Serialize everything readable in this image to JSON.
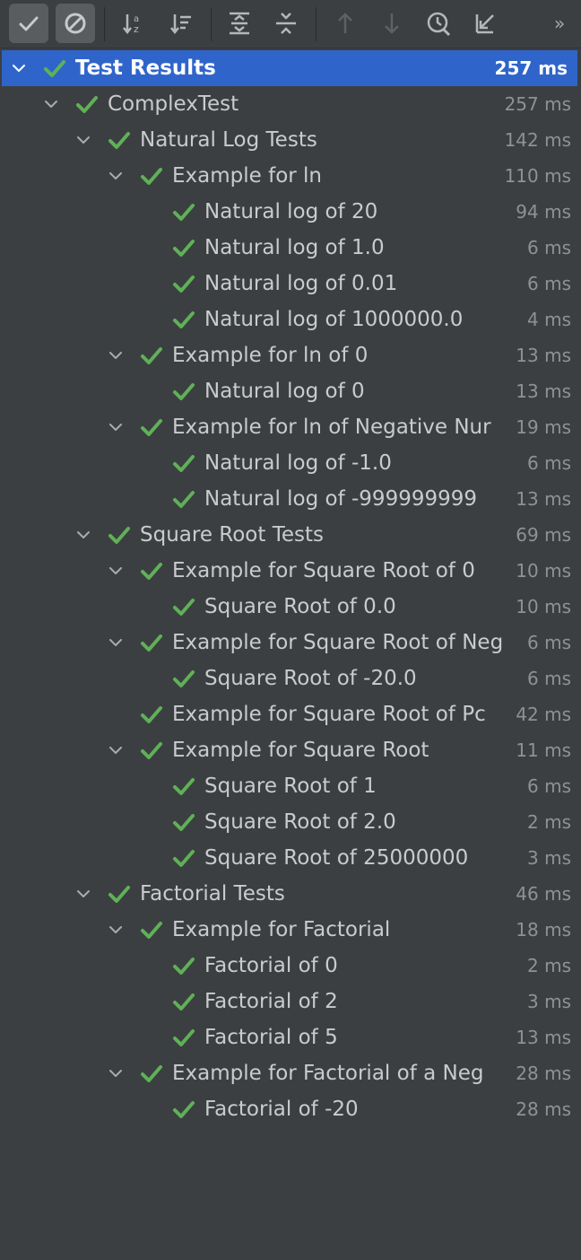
{
  "colors": {
    "background": "#3c3f41",
    "selection": "#2f65ca",
    "pass_check": "#5fb157",
    "text": "#c9cbcd",
    "time_text": "#8f9295"
  },
  "toolbar": {
    "buttons": [
      {
        "icon": "show-passed-icon",
        "active": true
      },
      {
        "icon": "show-ignored-icon",
        "active": true
      },
      {
        "icon": "sort-alphabetically-icon",
        "active": false
      },
      {
        "icon": "sort-by-duration-icon",
        "active": false
      },
      {
        "icon": "expand-all-icon",
        "active": false
      },
      {
        "icon": "collapse-all-icon",
        "active": false
      },
      {
        "icon": "previous-failed-icon",
        "active": false
      },
      {
        "icon": "next-failed-icon",
        "active": false
      },
      {
        "icon": "test-history-icon",
        "active": false
      },
      {
        "icon": "import-tests-icon",
        "active": false
      }
    ],
    "more_label": "»"
  },
  "tree": {
    "rows": [
      {
        "label": "Test Results",
        "time": "257 ms",
        "depth": 0,
        "expanded": true,
        "selected": true
      },
      {
        "label": "ComplexTest",
        "time": "257 ms",
        "depth": 1,
        "expanded": true
      },
      {
        "label": "Natural Log Tests",
        "time": "142 ms",
        "depth": 2,
        "expanded": true
      },
      {
        "label": "Example for ln",
        "time": "110 ms",
        "depth": 3,
        "expanded": true
      },
      {
        "label": "Natural log of 20",
        "time": "94 ms",
        "depth": 4
      },
      {
        "label": "Natural log of 1.0",
        "time": "6 ms",
        "depth": 4
      },
      {
        "label": "Natural log of 0.01",
        "time": "6 ms",
        "depth": 4
      },
      {
        "label": "Natural log of 1000000.0",
        "time": "4 ms",
        "depth": 4
      },
      {
        "label": "Example for ln of 0",
        "time": "13 ms",
        "depth": 3,
        "expanded": true
      },
      {
        "label": "Natural log of 0",
        "time": "13 ms",
        "depth": 4
      },
      {
        "label": "Example for ln of Negative Nur",
        "time": "19 ms",
        "depth": 3,
        "expanded": true
      },
      {
        "label": "Natural log of -1.0",
        "time": "6 ms",
        "depth": 4
      },
      {
        "label": "Natural log of -999999999",
        "time": "13 ms",
        "depth": 4
      },
      {
        "label": "Square Root Tests",
        "time": "69 ms",
        "depth": 2,
        "expanded": true
      },
      {
        "label": "Example for Square Root of 0",
        "time": "10 ms",
        "depth": 3,
        "expanded": true
      },
      {
        "label": "Square Root of 0.0",
        "time": "10 ms",
        "depth": 4
      },
      {
        "label": "Example for Square Root of Neg",
        "time": "6 ms",
        "depth": 3,
        "expanded": true
      },
      {
        "label": "Square Root of -20.0",
        "time": "6 ms",
        "depth": 4
      },
      {
        "label": "Example for Square Root of Pc",
        "time": "42 ms",
        "depth": 3
      },
      {
        "label": "Example for Square Root",
        "time": "11 ms",
        "depth": 3,
        "expanded": true
      },
      {
        "label": "Square Root of 1",
        "time": "6 ms",
        "depth": 4
      },
      {
        "label": "Square Root of 2.0",
        "time": "2 ms",
        "depth": 4
      },
      {
        "label": "Square Root of 25000000",
        "time": "3 ms",
        "depth": 4
      },
      {
        "label": "Factorial Tests",
        "time": "46 ms",
        "depth": 2,
        "expanded": true
      },
      {
        "label": "Example for Factorial",
        "time": "18 ms",
        "depth": 3,
        "expanded": true
      },
      {
        "label": "Factorial of 0",
        "time": "2 ms",
        "depth": 4
      },
      {
        "label": "Factorial of 2",
        "time": "3 ms",
        "depth": 4
      },
      {
        "label": "Factorial of 5",
        "time": "13 ms",
        "depth": 4
      },
      {
        "label": "Example for Factorial of a Neg",
        "time": "28 ms",
        "depth": 3,
        "expanded": true
      },
      {
        "label": "Factorial of -20",
        "time": "28 ms",
        "depth": 4
      }
    ]
  }
}
